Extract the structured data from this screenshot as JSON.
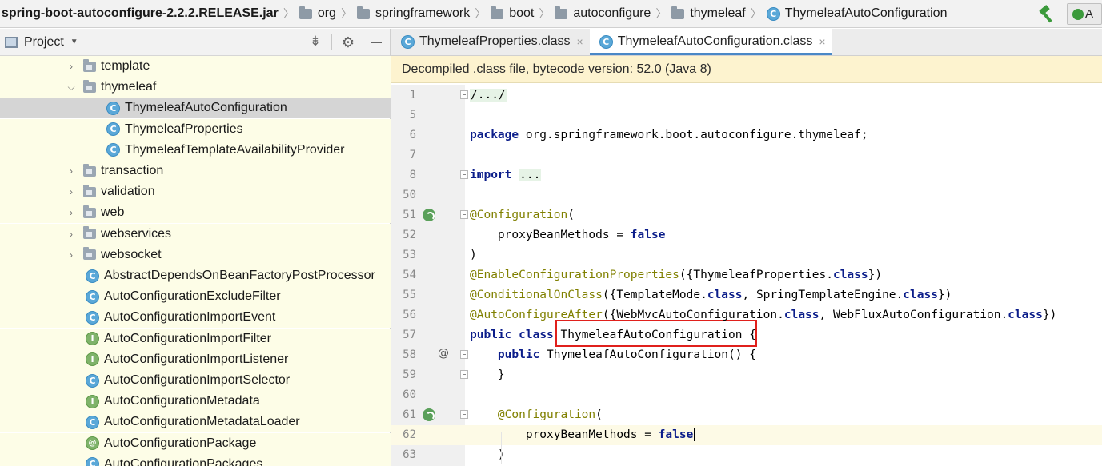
{
  "breadcrumb": {
    "jar": "spring-boot-autoconfigure-2.2.2.RELEASE.jar",
    "folders": [
      "org",
      "springframework",
      "boot",
      "autoconfigure",
      "thymeleaf"
    ],
    "class": "ThymeleafAutoConfiguration"
  },
  "toolbar": {
    "run_config_label": "A"
  },
  "project": {
    "title": "Project",
    "tree": [
      {
        "label": "template",
        "kind": "folder",
        "expanded": false,
        "depth": 1
      },
      {
        "label": "thymeleaf",
        "kind": "folder",
        "expanded": true,
        "depth": 1
      },
      {
        "label": "ThymeleafAutoConfiguration",
        "kind": "class",
        "depth": 2,
        "selected": true
      },
      {
        "label": "ThymeleafProperties",
        "kind": "class",
        "depth": 2
      },
      {
        "label": "ThymeleafTemplateAvailabilityProvider",
        "kind": "class",
        "depth": 2
      },
      {
        "label": "transaction",
        "kind": "folder",
        "expanded": false,
        "depth": 1
      },
      {
        "label": "validation",
        "kind": "folder",
        "expanded": false,
        "depth": 1
      },
      {
        "label": "web",
        "kind": "folder",
        "expanded": false,
        "depth": 1
      },
      {
        "label": "webservices",
        "kind": "folder",
        "expanded": false,
        "depth": 1
      },
      {
        "label": "websocket",
        "kind": "folder",
        "expanded": false,
        "depth": 1
      },
      {
        "label": "AbstractDependsOnBeanFactoryPostProcessor",
        "kind": "class",
        "depth": 1
      },
      {
        "label": "AutoConfigurationExcludeFilter",
        "kind": "class",
        "depth": 1
      },
      {
        "label": "AutoConfigurationImportEvent",
        "kind": "class",
        "depth": 1
      },
      {
        "label": "AutoConfigurationImportFilter",
        "kind": "interface",
        "depth": 1
      },
      {
        "label": "AutoConfigurationImportListener",
        "kind": "interface",
        "depth": 1
      },
      {
        "label": "AutoConfigurationImportSelector",
        "kind": "class",
        "depth": 1
      },
      {
        "label": "AutoConfigurationMetadata",
        "kind": "interface",
        "depth": 1
      },
      {
        "label": "AutoConfigurationMetadataLoader",
        "kind": "class",
        "depth": 1
      },
      {
        "label": "AutoConfigurationPackage",
        "kind": "annotation",
        "depth": 1
      },
      {
        "label": "AutoConfigurationPackages",
        "kind": "class",
        "depth": 1
      }
    ]
  },
  "editor": {
    "tabs": [
      {
        "label": "ThymeleafProperties.class",
        "active": false
      },
      {
        "label": "ThymeleafAutoConfiguration.class",
        "active": true
      }
    ],
    "banner": "Decompiled .class file, bytecode version: 52.0 (Java 8)",
    "lines": [
      {
        "num": "1",
        "fold": true,
        "parts": [
          [
            "folded",
            "/.../"
          ]
        ]
      },
      {
        "num": "5",
        "parts": []
      },
      {
        "num": "6",
        "parts": [
          [
            "kw",
            "package"
          ],
          [
            "t",
            " org.springframework.boot.autoconfigure.thymeleaf;"
          ]
        ]
      },
      {
        "num": "7",
        "parts": []
      },
      {
        "num": "8",
        "fold": true,
        "parts": [
          [
            "kw",
            "import"
          ],
          [
            "t",
            " "
          ],
          [
            "folded",
            "..."
          ]
        ]
      },
      {
        "num": "50",
        "parts": []
      },
      {
        "num": "51",
        "fold": true,
        "gutter": "bean",
        "parts": [
          [
            "anno",
            "@Configuration"
          ],
          [
            "t",
            "("
          ]
        ]
      },
      {
        "num": "52",
        "parts": [
          [
            "t",
            "    proxyBeanMethods = "
          ],
          [
            "kw",
            "false"
          ]
        ]
      },
      {
        "num": "53",
        "parts": [
          [
            "t",
            ")"
          ]
        ]
      },
      {
        "num": "54",
        "parts": [
          [
            "anno",
            "@EnableConfigurationProperties"
          ],
          [
            "t",
            "({ThymeleafProperties."
          ],
          [
            "kw",
            "class"
          ],
          [
            "t",
            "})"
          ]
        ]
      },
      {
        "num": "55",
        "parts": [
          [
            "anno",
            "@ConditionalOnClass"
          ],
          [
            "t",
            "({TemplateMode."
          ],
          [
            "kw",
            "class"
          ],
          [
            "t",
            ", SpringTemplateEngine."
          ],
          [
            "kw",
            "class"
          ],
          [
            "t",
            "})"
          ]
        ]
      },
      {
        "num": "56",
        "parts": [
          [
            "anno",
            "@AutoConfigureAfter"
          ],
          [
            "t",
            "({WebMvcAutoConfiguration."
          ],
          [
            "kw",
            "class"
          ],
          [
            "t",
            ", WebFluxAutoConfiguration."
          ],
          [
            "kw",
            "class"
          ],
          [
            "t",
            "})"
          ]
        ]
      },
      {
        "num": "57",
        "parts": [
          [
            "kw",
            "public"
          ],
          [
            "t",
            " "
          ],
          [
            "kw",
            "class"
          ],
          [
            "t",
            " ThymeleafAutoConfiguration {"
          ]
        ]
      },
      {
        "num": "58",
        "fold": true,
        "gutter": "override",
        "parts": [
          [
            "t",
            "    "
          ],
          [
            "kw",
            "public"
          ],
          [
            "t",
            " ThymeleafAutoConfiguration() {"
          ]
        ]
      },
      {
        "num": "59",
        "fold": true,
        "parts": [
          [
            "t",
            "    }"
          ]
        ]
      },
      {
        "num": "60",
        "parts": []
      },
      {
        "num": "61",
        "fold": true,
        "gutter": "bean",
        "parts": [
          [
            "t",
            "    "
          ],
          [
            "anno",
            "@Configuration"
          ],
          [
            "t",
            "("
          ]
        ]
      },
      {
        "num": "62",
        "caret": true,
        "parts": [
          [
            "t",
            "        proxyBeanMethods = "
          ],
          [
            "kw",
            "false"
          ]
        ]
      },
      {
        "num": "63",
        "parts": [
          [
            "t",
            "    )"
          ]
        ]
      }
    ]
  }
}
